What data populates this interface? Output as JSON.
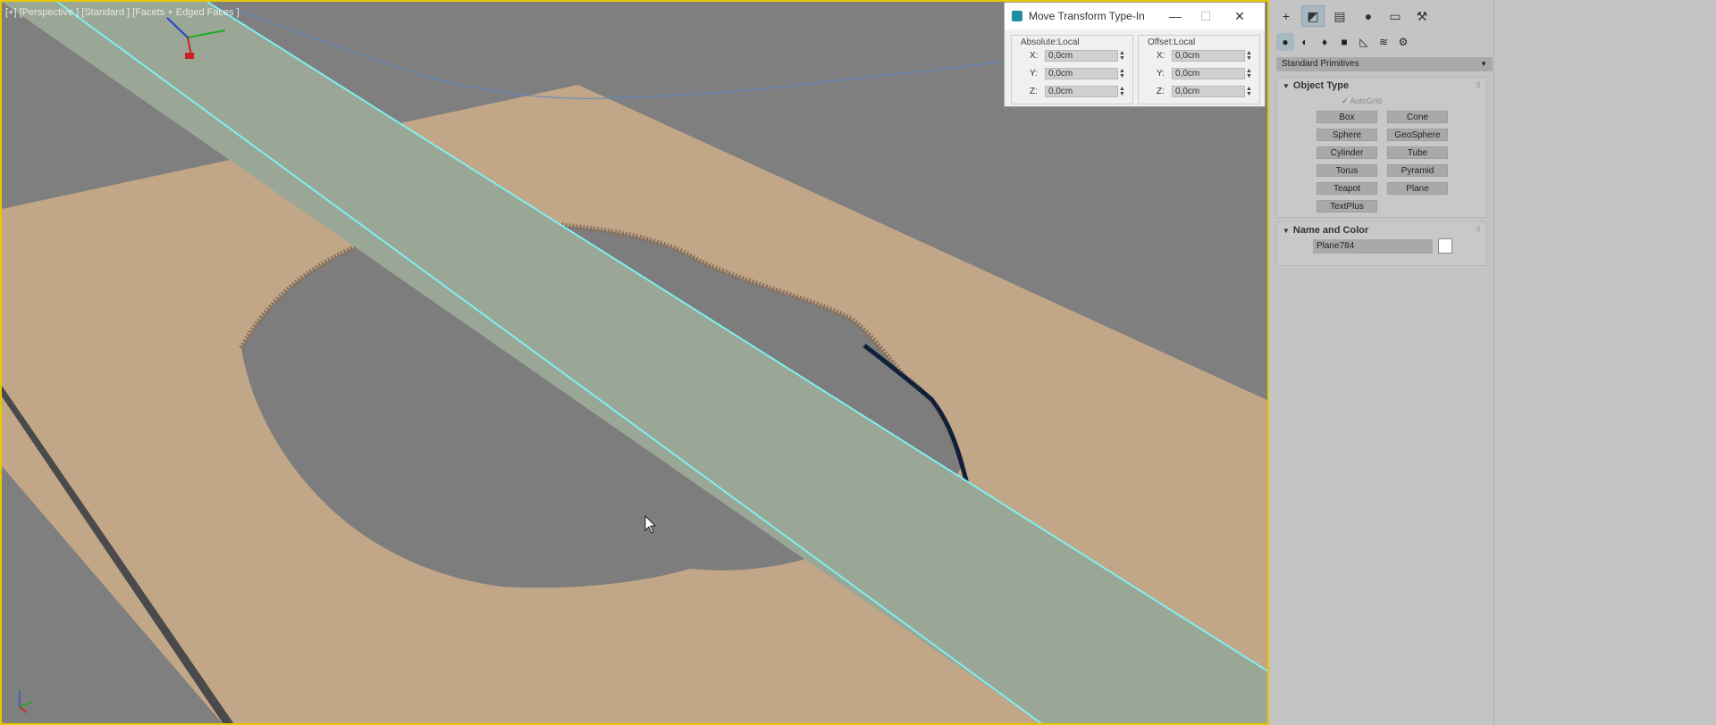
{
  "viewport": {
    "label": "[+] [Perspective ] [Standard ] [Facets + Edged Faces ]",
    "colors": {
      "background": "#7f7f7f",
      "ground": "#c2a688",
      "road": "#9aa796",
      "road_edge": "#7ef0f0",
      "border": "#e6c800"
    }
  },
  "dialog": {
    "title": "Move Transform Type-In",
    "absolute": {
      "label": "Absolute:Local",
      "x_axis": "X:",
      "y_axis": "Y:",
      "z_axis": "Z:",
      "x": "0,0cm",
      "y": "0,0cm",
      "z": "0,0cm"
    },
    "offset": {
      "label": "Offset:Local",
      "x_axis": "X:",
      "y_axis": "Y:",
      "z_axis": "Z:",
      "x": "0,0cm",
      "y": "0,0cm",
      "z": "0,0cm"
    }
  },
  "panel": {
    "tabs": [
      "create-icon",
      "modify-icon",
      "hierarchy-icon",
      "motion-icon",
      "display-icon",
      "utilities-icon"
    ],
    "subcategories": [
      "geometry-icon",
      "shapes-icon",
      "lights-icon",
      "cameras-icon",
      "helpers-icon",
      "spacewarps-icon",
      "systems-icon"
    ],
    "category": "Standard Primitives",
    "object_type": {
      "title": "Object Type",
      "autogrid": "AutoGrid",
      "buttons": [
        "Box",
        "Cone",
        "Sphere",
        "GeoSphere",
        "Cylinder",
        "Tube",
        "Torus",
        "Pyramid",
        "Teapot",
        "Plane",
        "TextPlus"
      ]
    },
    "name_and_color": {
      "title": "Name and Color",
      "name": "Plane784",
      "color": "#ffffff"
    }
  }
}
